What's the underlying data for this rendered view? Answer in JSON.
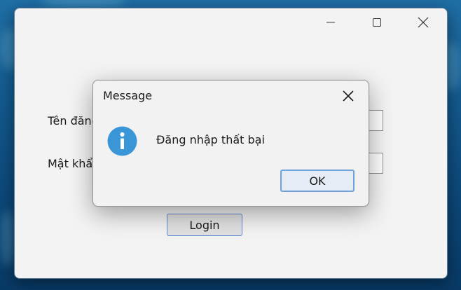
{
  "main_window": {
    "username_label": "Tên đăng",
    "password_label": "Mật khẩ",
    "login_button": "Login"
  },
  "dialog": {
    "title": "Message",
    "message": "Đăng nhập thất bại",
    "ok_button": "OK",
    "icon": "info-icon"
  },
  "colors": {
    "info_icon": "#3a96d6",
    "button_focus_border": "#6fa2d8",
    "dialog_background": "#f2f2f2"
  }
}
